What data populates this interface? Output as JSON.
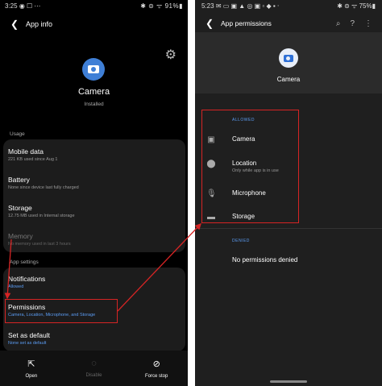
{
  "left": {
    "status": {
      "time": "3:25",
      "icons": "◉ ☐ ⋯",
      "right": "✱ ⊜ ᯤ 91%▮"
    },
    "title": "App info",
    "app_name": "Camera",
    "app_status": "Installed",
    "usage_label": "Usage",
    "usage": [
      {
        "title": "Mobile data",
        "sub": "221 KB used since Aug 1"
      },
      {
        "title": "Battery",
        "sub": "None since device last fully charged"
      },
      {
        "title": "Storage",
        "sub": "12.75 MB used in Internal storage"
      },
      {
        "title": "Memory",
        "sub": "No memory used in last 3 hours"
      }
    ],
    "settings_label": "App settings",
    "settings": [
      {
        "title": "Notifications",
        "sub": "Allowed"
      },
      {
        "title": "Permissions",
        "sub": "Camera, Location, Microphone, and Storage"
      },
      {
        "title": "Set as default",
        "sub": "None set as default"
      }
    ],
    "nav": [
      {
        "label": "Open",
        "icon": "⇱"
      },
      {
        "label": "Disable",
        "icon": "◌"
      },
      {
        "label": "Force stop",
        "icon": "⊘"
      }
    ]
  },
  "right": {
    "status": {
      "time": "5:23",
      "icons": "✉ ▭ ▣ ▲ ◎ ▣ ▫ ◆ ▪ ⋅",
      "right": "✱ ⊜ ᯤ 75%▮"
    },
    "title": "App permissions",
    "actions": {
      "search": "⌕",
      "help": "?",
      "more": "⋮"
    },
    "app_name": "Camera",
    "allowed_label": "ALLOWED",
    "allowed": [
      {
        "title": "Camera",
        "sub": "",
        "icon": "▣"
      },
      {
        "title": "Location",
        "sub": "Only while app is in use",
        "icon": "⬤"
      },
      {
        "title": "Microphone",
        "sub": "",
        "icon": "🎙"
      },
      {
        "title": "Storage",
        "sub": "",
        "icon": "▬"
      }
    ],
    "denied_label": "DENIED",
    "denied_text": "No permissions denied"
  },
  "colors": {
    "highlight": "#d62424",
    "accent": "#5b9cf3",
    "app_icon": "#3f7fd6"
  }
}
